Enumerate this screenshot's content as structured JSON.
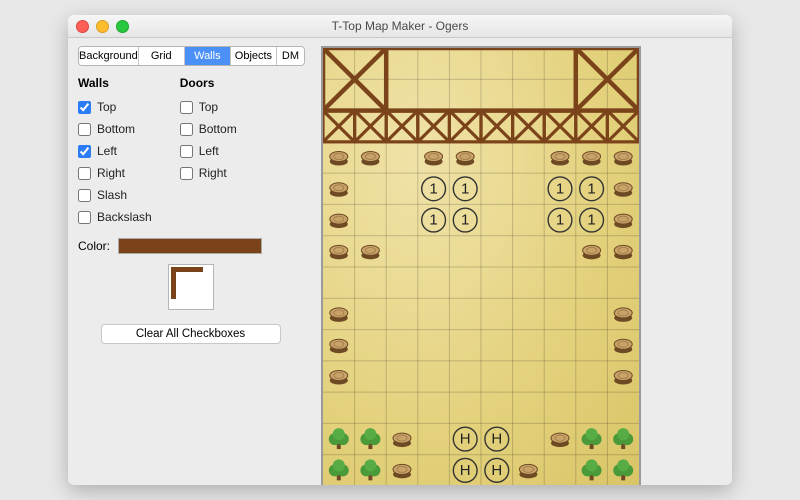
{
  "window": {
    "title": "T-Top Map Maker - Ogers"
  },
  "tabs": [
    {
      "label": "Background",
      "selected": false
    },
    {
      "label": "Grid",
      "selected": false
    },
    {
      "label": "Walls",
      "selected": true
    },
    {
      "label": "Objects",
      "selected": false
    },
    {
      "label": "DM",
      "selected": false
    }
  ],
  "walls": {
    "heading": "Walls",
    "options": [
      {
        "label": "Top",
        "checked": true
      },
      {
        "label": "Bottom",
        "checked": false
      },
      {
        "label": "Left",
        "checked": true
      },
      {
        "label": "Right",
        "checked": false
      },
      {
        "label": "Slash",
        "checked": false
      },
      {
        "label": "Backslash",
        "checked": false
      }
    ]
  },
  "doors": {
    "heading": "Doors",
    "options": [
      {
        "label": "Top",
        "checked": false
      },
      {
        "label": "Bottom",
        "checked": false
      },
      {
        "label": "Left",
        "checked": false
      },
      {
        "label": "Right",
        "checked": false
      }
    ]
  },
  "color": {
    "label": "Color:",
    "value": "#7b431a"
  },
  "clear_button": "Clear All Checkboxes",
  "map": {
    "cols": 10,
    "rows": 14,
    "tokens": [
      {
        "col": 3,
        "row": 4,
        "text": "1"
      },
      {
        "col": 4,
        "row": 4,
        "text": "1"
      },
      {
        "col": 7,
        "row": 4,
        "text": "1"
      },
      {
        "col": 8,
        "row": 4,
        "text": "1"
      },
      {
        "col": 3,
        "row": 5,
        "text": "1"
      },
      {
        "col": 4,
        "row": 5,
        "text": "1"
      },
      {
        "col": 7,
        "row": 5,
        "text": "1"
      },
      {
        "col": 8,
        "row": 5,
        "text": "1"
      },
      {
        "col": 4,
        "row": 12,
        "text": "H"
      },
      {
        "col": 5,
        "row": 12,
        "text": "H"
      },
      {
        "col": 4,
        "row": 13,
        "text": "H"
      },
      {
        "col": 5,
        "row": 13,
        "text": "H"
      }
    ],
    "trees": [
      {
        "c": 0,
        "r": 12
      },
      {
        "c": 1,
        "r": 12
      },
      {
        "c": 0,
        "r": 13
      },
      {
        "c": 1,
        "r": 13
      },
      {
        "c": 8,
        "r": 12
      },
      {
        "c": 9,
        "r": 12
      },
      {
        "c": 8,
        "r": 13
      },
      {
        "c": 9,
        "r": 13
      }
    ],
    "stumps": [
      {
        "c": 0,
        "r": 3
      },
      {
        "c": 1,
        "r": 3
      },
      {
        "c": 3,
        "r": 3
      },
      {
        "c": 4,
        "r": 3
      },
      {
        "c": 7,
        "r": 3
      },
      {
        "c": 8,
        "r": 3
      },
      {
        "c": 9,
        "r": 3
      },
      {
        "c": 0,
        "r": 4
      },
      {
        "c": 9,
        "r": 4
      },
      {
        "c": 0,
        "r": 5
      },
      {
        "c": 9,
        "r": 5
      },
      {
        "c": 0,
        "r": 6
      },
      {
        "c": 1,
        "r": 6
      },
      {
        "c": 8,
        "r": 6
      },
      {
        "c": 9,
        "r": 6
      },
      {
        "c": 0,
        "r": 8
      },
      {
        "c": 9,
        "r": 8
      },
      {
        "c": 0,
        "r": 9
      },
      {
        "c": 9,
        "r": 9
      },
      {
        "c": 0,
        "r": 10
      },
      {
        "c": 9,
        "r": 10
      },
      {
        "c": 2,
        "r": 12
      },
      {
        "c": 2,
        "r": 13
      },
      {
        "c": 7,
        "r": 12
      },
      {
        "c": 6,
        "r": 13
      }
    ]
  }
}
